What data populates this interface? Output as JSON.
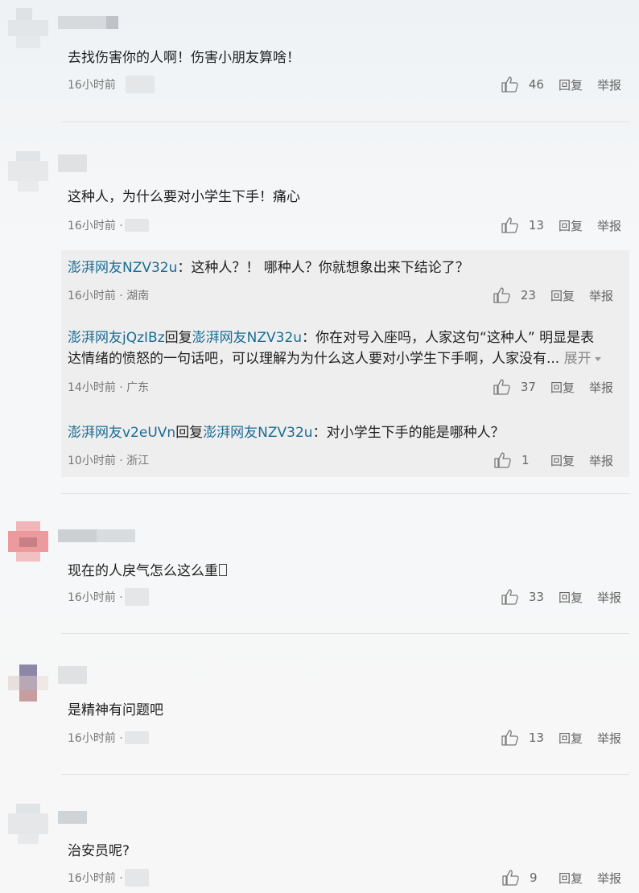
{
  "comments": [
    {
      "text": "去找伤害你的人啊！伤害小朋友算啥！",
      "time": "16小时前",
      "likes": "46",
      "reply_label": "回复",
      "report_label": "举报"
    },
    {
      "text": "这种人，为什么要对小学生下手！痛心",
      "time": "16小时前 ·",
      "likes": "13",
      "reply_label": "回复",
      "report_label": "举报",
      "replies": [
        {
          "user": "澎湃网友NZV32u",
          "colon": "：",
          "text": "这种人？！ 哪种人？你就想象出来下结论了？",
          "time": "16小时前 · 湖南",
          "likes": "23",
          "reply_label": "回复",
          "report_label": "举报"
        },
        {
          "user": "澎湃网友jQzIBz",
          "reply_word": "回复",
          "target": "澎湃网友NZV32u",
          "colon": "：",
          "text_line1": "你在对号入座吗，人家这句“这种人” 明显是表",
          "text_line2": "达情绪的愤怒的一句话吧，可以理解为为什么这人要对小学生下手啊，人家没有...",
          "expand_label": "展开",
          "time": "14小时前 · 广东",
          "likes": "37",
          "reply_label": "回复",
          "report_label": "举报"
        },
        {
          "user": "澎湃网友v2eUVn",
          "reply_word": "回复",
          "target": "澎湃网友NZV32u",
          "colon": "：",
          "text": "对小学生下手的能是哪种人？",
          "time": "10小时前 · 浙江",
          "likes": "1",
          "reply_label": "回复",
          "report_label": "举报"
        }
      ]
    },
    {
      "text": "现在的人戾气怎么这么重",
      "time": "16小时前 ·",
      "likes": "33",
      "reply_label": "回复",
      "report_label": "举报"
    },
    {
      "text": "是精神有问题吧",
      "time": "16小时前 ·",
      "likes": "13",
      "reply_label": "回复",
      "report_label": "举报"
    },
    {
      "text": "治安员呢?",
      "time": "16小时前 ·",
      "likes": "9",
      "reply_label": "回复",
      "report_label": "举报"
    }
  ],
  "colors": {
    "username_link": "#1b6c94",
    "subreply_bg": "#eeeeee",
    "meta_text": "#777777"
  },
  "icons": {
    "like": "thumbs-up-icon"
  }
}
